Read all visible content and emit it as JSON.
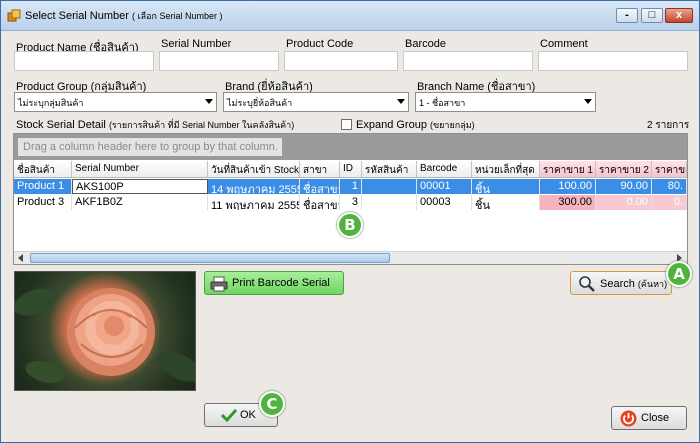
{
  "window": {
    "title": "Select Serial Number",
    "title_small": "( เลือก Serial Number )",
    "controls": {
      "minimize": "-",
      "maximize": "□",
      "close": "x"
    }
  },
  "filters": {
    "product_name_label": "Product Name (ชื่อสินค้า)",
    "serial_number_label": "Serial Number",
    "product_code_label": "Product Code",
    "barcode_label": "Barcode",
    "comment_label": "Comment",
    "product_group_label": "Product Group (กลุ่มสินค้า)",
    "product_group_value": "ไม่ระบุกลุ่มสินค้า",
    "brand_label": "Brand (ยี่ห้อสินค้า)",
    "brand_value": "ไม่ระบุยี่ห้อสินค้า",
    "branch_label": "Branch Name (ชื่อสาขา)",
    "branch_value": "1 - ชื่อสาขา"
  },
  "detail": {
    "label": "Stock Serial Detail",
    "label_small": "(รายการสินค้า ที่มี Serial Number ในคลังสินค้า)",
    "expand_group_label": "Expand Group",
    "expand_group_small": "(ขยายกลุ่ม)",
    "count": "2 รายการ"
  },
  "grid": {
    "group_hint": "Drag a column header here to group by that column.",
    "columns": [
      "ชื่อสินค้า",
      "Serial Number",
      "วันที่สินค้าเข้า Stock",
      "สาขา",
      "ID",
      "รหัสสินค้า",
      "Barcode",
      "หน่วยเล็กที่สุด",
      "ราคาขาย 1",
      "ราคาขาย 2",
      "ราคาขาย 3"
    ],
    "rows": [
      {
        "product": "Product 1",
        "serial": "AKS100P",
        "date": "14 พฤษภาคม 2555",
        "branch": "ชื่อสาขา",
        "id": "1",
        "code": "",
        "barcode": "00001",
        "unit": "ชิ้น",
        "price1": "100.00",
        "price2": "90.00",
        "price3": "80."
      },
      {
        "product": "Product 3",
        "serial": "AKF1B0Z",
        "date": "11 พฤษภาคม 2555",
        "branch": "ชื่อสาขา",
        "id": "3",
        "code": "",
        "barcode": "00003",
        "unit": "ชิ้น",
        "price1": "300.00",
        "price2": "0.00",
        "price3": "0."
      }
    ]
  },
  "buttons": {
    "print_barcode": "Print Barcode Serial",
    "search": "Search",
    "search_small": "(ค้นหา)",
    "ok": "OK",
    "close": "Close"
  },
  "badges": {
    "a": "A",
    "b": "B",
    "c": "C"
  },
  "icons": {
    "app": "app-icon",
    "printer": "printer-icon",
    "search": "magnifier-icon",
    "ok": "check-icon",
    "close": "power-icon",
    "photo": "rose-photo"
  },
  "colors": {
    "selection": "#3a8ee6",
    "price_highlight": "#f6b4bf",
    "green_button": "#6fd561",
    "badge": "#4fb33e",
    "window_bg": "#ece9e4"
  }
}
